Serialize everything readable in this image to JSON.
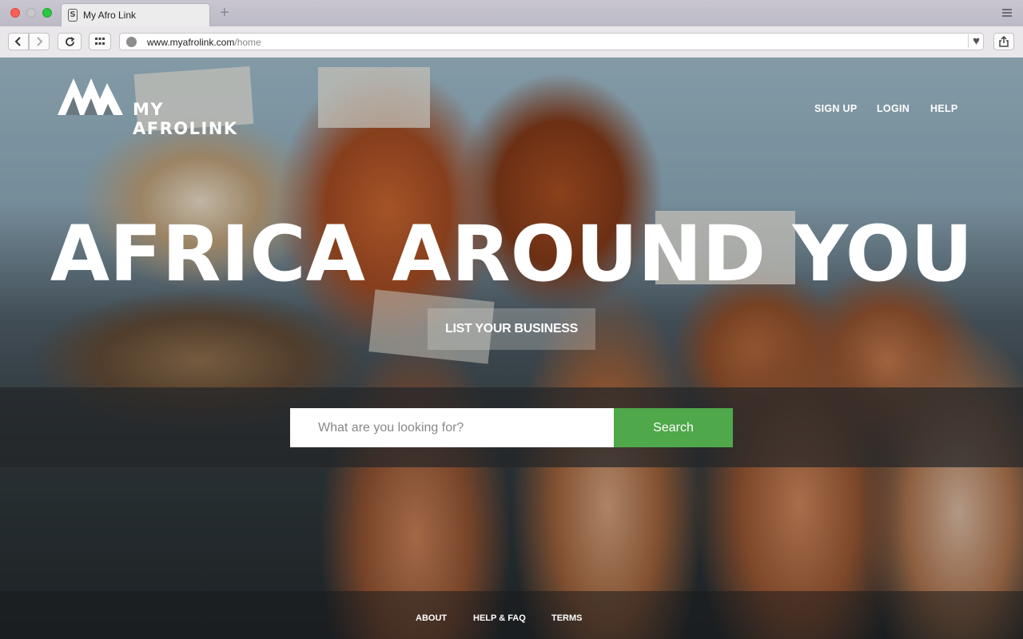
{
  "browser": {
    "tab_title": "My Afro Link",
    "new_tab_symbol": "+",
    "url_domain": "www.myafrolink.com",
    "url_path": "/home",
    "icons": {
      "back": "chevron-left-icon",
      "forward": "chevron-right-icon",
      "reload": "reload-icon",
      "tabs_grid": "grid-icon",
      "bookmark": "heart-icon",
      "share": "share-icon"
    }
  },
  "site": {
    "logo_text": "MY AFROLINK",
    "nav": {
      "sign_up": "SIGN UP",
      "login": "LOGIN",
      "help": "HELP"
    },
    "hero": {
      "title": "AFRICA AROUND YOU",
      "list_business": "LIST YOUR BUSINESS"
    },
    "search": {
      "placeholder": "What are you looking for?",
      "button": "Search"
    },
    "footer": {
      "about": "ABOUT",
      "help_faq": "HELP & FAQ",
      "terms": "TERMS"
    }
  },
  "colors": {
    "search_button": "#4fa84a",
    "hero_text": "#ffffff"
  }
}
